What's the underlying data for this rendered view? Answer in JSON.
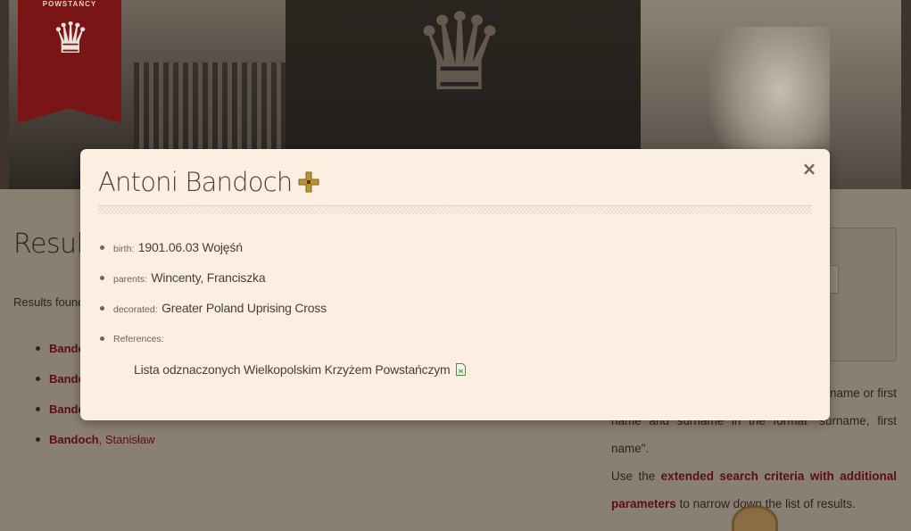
{
  "ribbon": {
    "text": "POWSTAŃCY"
  },
  "page": {
    "results_title": "Results",
    "results_found_label": "Results found",
    "results": [
      {
        "surname": "Bandoch",
        "given": ""
      },
      {
        "surname": "Bandoch",
        "given": ""
      },
      {
        "surname": "Bandoch",
        "given": ""
      },
      {
        "surname": "Bandoch",
        "given": ", Stanisław"
      }
    ],
    "side_text_partial_1": "name or first",
    "side_text_partial_2": "name and surname in the format \"surname, first name\".",
    "side_text_use": "Use the",
    "side_text_link": "extended search criteria with additional parameters",
    "side_text_tail": "to narrow down the list of results."
  },
  "modal": {
    "title": "Antoni Bandoch",
    "close_label": "×",
    "birth_label": "birth:",
    "birth_value": "1901.06.03 Wojęśń",
    "parents_label": "parents:",
    "parents_value": "Wincenty, Franciszka",
    "decorated_label": "decorated:",
    "decorated_value": "Greater Poland Uprising Cross",
    "references_label": "References:",
    "reference_title": "Lista odznaczonych Wielkopolskim Krzyżem Powstańczym"
  },
  "colors": {
    "modal_bg": "#fdeee2",
    "accent_dark_red": "#5a0e10",
    "ribbon_red": "#7a1516",
    "cross_gold": "#b8962e"
  },
  "icons": {
    "close": "close-icon",
    "cross": "uprising-cross-icon",
    "document": "document-icon"
  }
}
